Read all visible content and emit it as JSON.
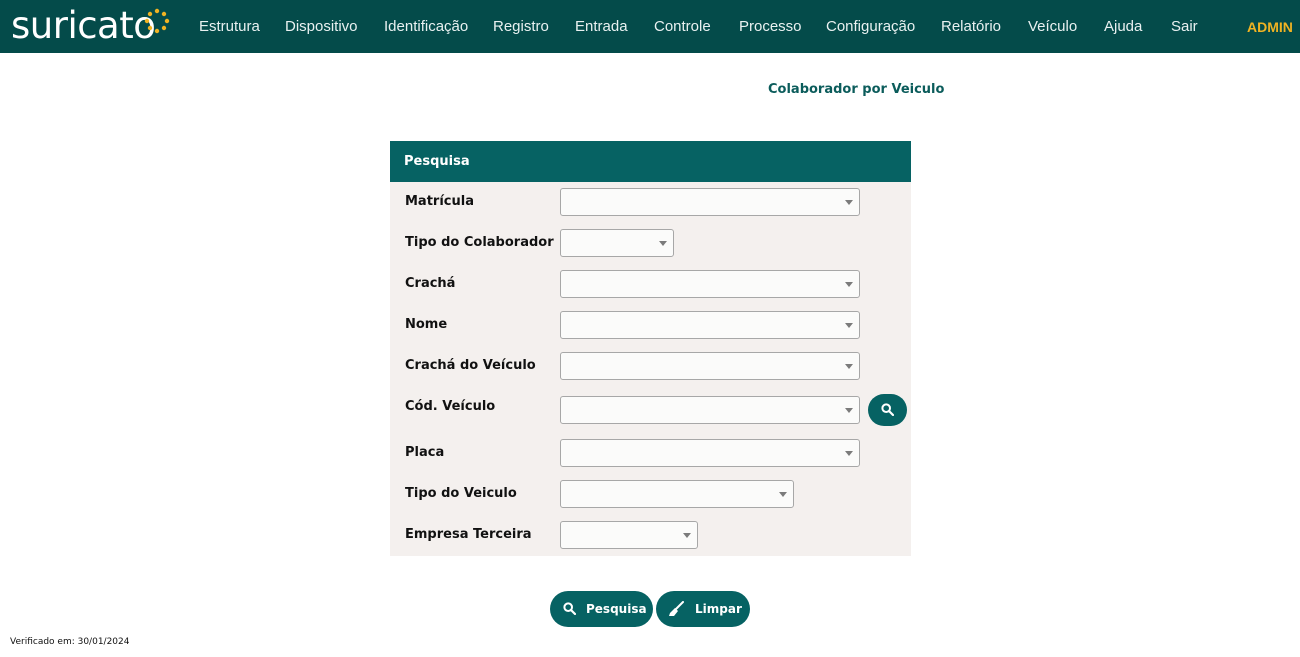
{
  "brand": {
    "logo_text": "suricato"
  },
  "nav": {
    "items": [
      "Estrutura",
      "Dispositivo",
      "Identificação",
      "Registro",
      "Entrada",
      "Controle",
      "Processo",
      "Configuração",
      "Relatório",
      "Veículo",
      "Ajuda",
      "Sair"
    ],
    "user": "ADMIN"
  },
  "page": {
    "title": "Colaborador por Veiculo"
  },
  "panel": {
    "title": "Pesquisa",
    "fields": [
      {
        "label": "Matrícula",
        "value": ""
      },
      {
        "label": "Tipo do Colaborador",
        "value": ""
      },
      {
        "label": "Crachá",
        "value": ""
      },
      {
        "label": "Nome",
        "value": ""
      },
      {
        "label": "Crachá do Veículo",
        "value": ""
      },
      {
        "label": "Cód. Veículo",
        "value": ""
      },
      {
        "label": "Placa",
        "value": ""
      },
      {
        "label": "Tipo do Veiculo",
        "value": ""
      },
      {
        "label": "Empresa Terceira",
        "value": ""
      }
    ]
  },
  "actions": {
    "search_label": "Pesquisa",
    "clear_label": "Limpar"
  },
  "footer": {
    "verified_text": "Verificado em: 30/01/2024"
  },
  "colors": {
    "primary": "#066263",
    "topbar": "#044b4a",
    "accent": "#f0b323",
    "panel_bg": "#f4f0ee"
  },
  "icons": {
    "logo_dots": "sun-dots-icon",
    "search": "search-icon",
    "clear": "broom-icon",
    "dropdown": "chevron-down-icon"
  }
}
